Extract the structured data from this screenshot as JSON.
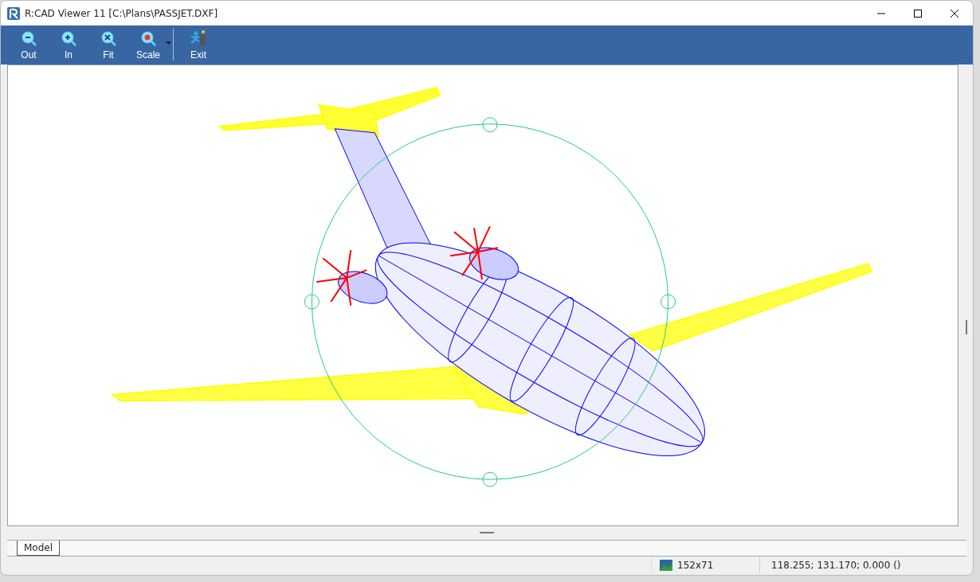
{
  "window": {
    "title": "R:CAD Viewer 11 [C:\\Plans\\PASSJET.DXF]"
  },
  "toolbar": {
    "buttons": [
      {
        "label": "Out",
        "kind": "zoom-out",
        "has_dropdown": false
      },
      {
        "label": "In",
        "kind": "zoom-in",
        "has_dropdown": false
      },
      {
        "label": "Fit",
        "kind": "fit",
        "has_dropdown": false
      },
      {
        "label": "Scale",
        "kind": "scale",
        "has_dropdown": true
      },
      {
        "label": "Exit",
        "kind": "exit",
        "has_dropdown": false
      }
    ]
  },
  "tabs": [
    {
      "label": "Model",
      "selected": true
    }
  ],
  "status_bar": {
    "image_size": "152x71",
    "coordinates": "118.255; 131.170; 0.000 ()"
  }
}
